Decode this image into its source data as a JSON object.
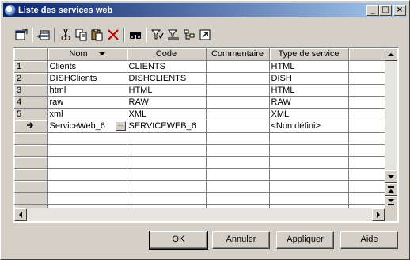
{
  "window": {
    "title": "Liste des services web",
    "controls": {
      "minimize": "_",
      "maximize": "□",
      "close": "×"
    }
  },
  "toolbar": {
    "icons": [
      "properties-icon",
      "insert-row-icon",
      "cut-icon",
      "copy-icon",
      "paste-icon",
      "delete-icon",
      "find-icon",
      "filter-icon",
      "sort-icon",
      "tree-icon",
      "goto-icon"
    ]
  },
  "grid": {
    "columns": [
      "",
      "Nom",
      "Code",
      "Commentaire",
      "Type de service"
    ],
    "rows": [
      {
        "index": "1",
        "nom": "Clients",
        "code": "CLIENTS",
        "commentaire": "",
        "type": "HTML"
      },
      {
        "index": "2",
        "nom": "DISHClients",
        "code": "DISHCLIENTS",
        "commentaire": "",
        "type": "DISH"
      },
      {
        "index": "3",
        "nom": "html",
        "code": "HTML",
        "commentaire": "",
        "type": "HTML"
      },
      {
        "index": "4",
        "nom": "raw",
        "code": "RAW",
        "commentaire": "",
        "type": "RAW"
      },
      {
        "index": "5",
        "nom": "xml",
        "code": "XML",
        "commentaire": "",
        "type": "XML"
      }
    ],
    "editing_row": {
      "nom_before_caret": "Service",
      "nom_after_caret": "Web_6",
      "code": "SERVICEWEB_6",
      "commentaire": "",
      "type": "<Non défini>",
      "ellipsis": "..."
    },
    "empty_rows": 8
  },
  "buttons": {
    "ok": "OK",
    "cancel": "Annuler",
    "apply": "Appliquer",
    "help": "Aide"
  }
}
